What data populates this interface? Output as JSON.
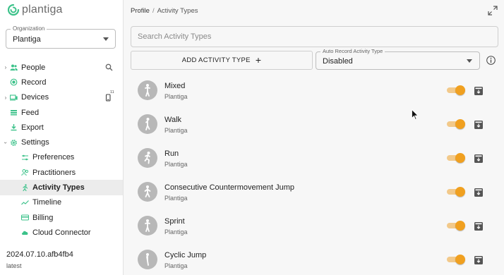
{
  "brand": {
    "name": "plantiga",
    "accent": "#3cc28a"
  },
  "organization": {
    "label": "Organization",
    "value": "Plantiga"
  },
  "nav": [
    {
      "label": "People",
      "icon": "people-icon",
      "expandable": true
    },
    {
      "label": "Record",
      "icon": "record-icon"
    },
    {
      "label": "Devices",
      "icon": "devices-icon",
      "expandable": true,
      "badge": "11"
    },
    {
      "label": "Feed",
      "icon": "feed-icon"
    },
    {
      "label": "Export",
      "icon": "export-icon"
    },
    {
      "label": "Settings",
      "icon": "gear-icon",
      "expanded": true
    }
  ],
  "settings_items": [
    {
      "label": "Preferences",
      "icon": "preferences-icon"
    },
    {
      "label": "Practitioners",
      "icon": "practitioners-icon"
    },
    {
      "label": "Activity Types",
      "icon": "running-icon",
      "active": true
    },
    {
      "label": "Timeline",
      "icon": "timeline-icon"
    },
    {
      "label": "Billing",
      "icon": "billing-icon"
    },
    {
      "label": "Cloud Connector",
      "icon": "cloud-icon"
    }
  ],
  "version": {
    "build": "2024.07.10.afb4fb4",
    "channel": "latest"
  },
  "breadcrumb": {
    "root": "Profile",
    "separator": "/",
    "current": "Activity Types"
  },
  "search": {
    "placeholder": "Search Activity Types",
    "value": ""
  },
  "add_button": {
    "label": "ADD ACTIVITY TYPE",
    "icon": "plus-icon"
  },
  "auto_record": {
    "label": "Auto Record Activity Type",
    "value": "Disabled"
  },
  "activity_types": [
    {
      "name": "Mixed",
      "owner": "Plantiga",
      "enabled": true,
      "icon": "standing-figure-icon"
    },
    {
      "name": "Walk",
      "owner": "Plantiga",
      "enabled": true,
      "icon": "walking-figure-icon"
    },
    {
      "name": "Run",
      "owner": "Plantiga",
      "enabled": true,
      "icon": "running-figure-icon"
    },
    {
      "name": "Consecutive Countermovement Jump",
      "owner": "Plantiga",
      "enabled": true,
      "icon": "jumping-figure-icon"
    },
    {
      "name": "Sprint",
      "owner": "Plantiga",
      "enabled": true,
      "icon": "standing-figure-icon"
    },
    {
      "name": "Cyclic Jump",
      "owner": "Plantiga",
      "enabled": true,
      "icon": "jumping-figure-icon"
    }
  ],
  "colors": {
    "toggle_on": "#f0a020",
    "toggle_track": "#f2c98a",
    "icon_green": "#3cc28a"
  }
}
